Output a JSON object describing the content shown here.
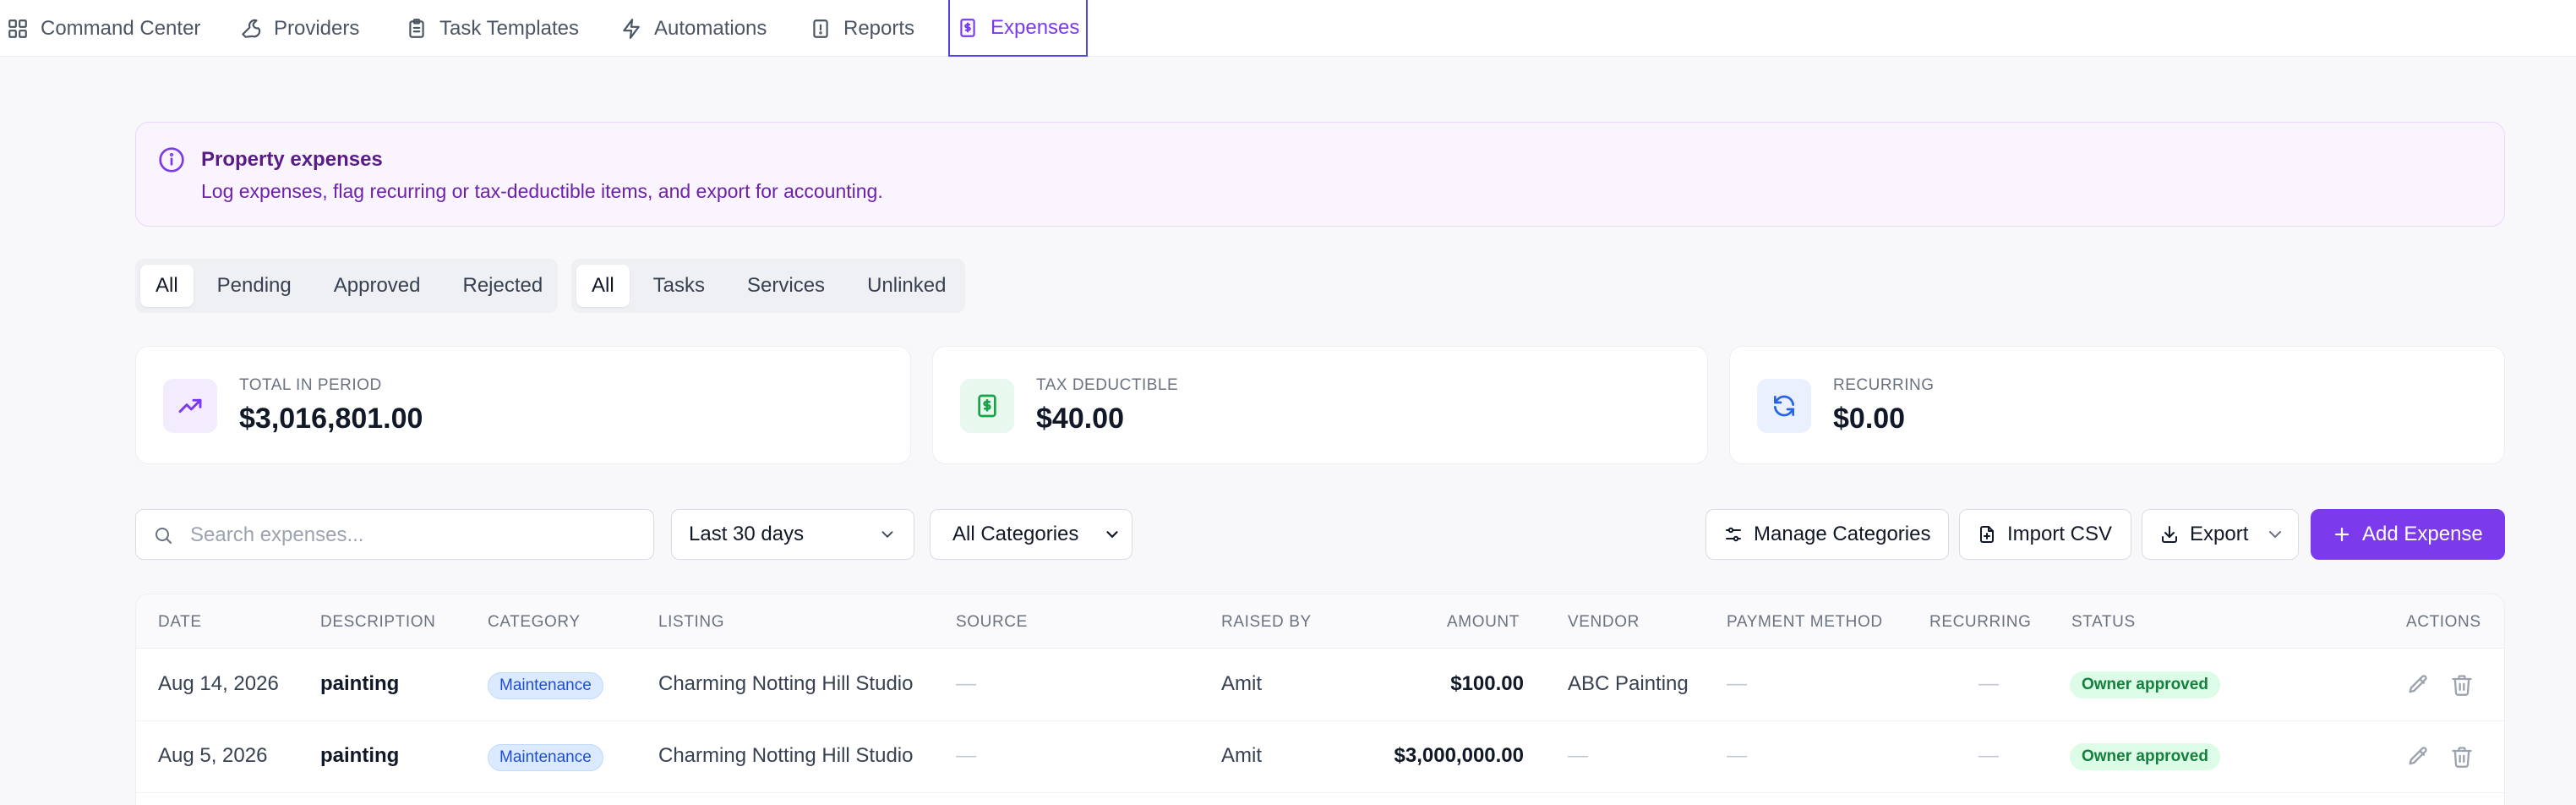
{
  "nav": {
    "tabs": [
      {
        "label": "Command Center",
        "icon": "grid-icon"
      },
      {
        "label": "Providers",
        "icon": "wrench-icon"
      },
      {
        "label": "Task Templates",
        "icon": "clipboard-icon"
      },
      {
        "label": "Automations",
        "icon": "bolt-icon"
      },
      {
        "label": "Reports",
        "icon": "report-icon"
      },
      {
        "label": "Expenses",
        "icon": "receipt-icon",
        "active": true
      }
    ]
  },
  "banner": {
    "title": "Property expenses",
    "text": "Log expenses, flag recurring or tax-deductible items, and export for accounting."
  },
  "status_filter": {
    "options": [
      "All",
      "Pending",
      "Approved",
      "Rejected"
    ],
    "selected": "All"
  },
  "link_filter": {
    "options": [
      "All",
      "Tasks",
      "Services",
      "Unlinked"
    ],
    "selected": "All"
  },
  "stats": [
    {
      "label": "TOTAL IN PERIOD",
      "value": "$3,016,801.00",
      "icon": "trending-up-icon",
      "color": "#7c3aed"
    },
    {
      "label": "TAX DEDUCTIBLE",
      "value": "$40.00",
      "icon": "dollar-receipt-icon",
      "color": "#16a34a"
    },
    {
      "label": "RECURRING",
      "value": "$0.00",
      "icon": "refresh-icon",
      "color": "#2563eb"
    }
  ],
  "toolbar": {
    "search_placeholder": "Search expenses...",
    "period": "Last 30 days",
    "category": "All Categories",
    "manage_categories": "Manage Categories",
    "import_csv": "Import CSV",
    "export": "Export",
    "add_expense": "Add Expense"
  },
  "table": {
    "columns": [
      "DATE",
      "DESCRIPTION",
      "CATEGORY",
      "LISTING",
      "SOURCE",
      "RAISED BY",
      "AMOUNT",
      "VENDOR",
      "PAYMENT METHOD",
      "RECURRING",
      "STATUS",
      "ACTIONS"
    ],
    "rows": [
      {
        "date": "Aug 14, 2026",
        "description": "painting",
        "category": "Maintenance",
        "listing": "Charming Notting Hill Studio",
        "source": "—",
        "raised_by": "Amit",
        "amount": "$100.00",
        "vendor": "ABC Painting",
        "payment_method": "—",
        "recurring": "—",
        "status": "Owner approved"
      },
      {
        "date": "Aug 5, 2026",
        "description": "painting",
        "category": "Maintenance",
        "listing": "Charming Notting Hill Studio",
        "source": "—",
        "raised_by": "Amit",
        "amount": "$3,000,000.00",
        "vendor": "—",
        "payment_method": "—",
        "recurring": "—",
        "status": "Owner approved"
      }
    ]
  },
  "colors": {
    "accent": "#7c3aed",
    "status_green": "#15803d",
    "category_blue": "#1d4ed8"
  }
}
